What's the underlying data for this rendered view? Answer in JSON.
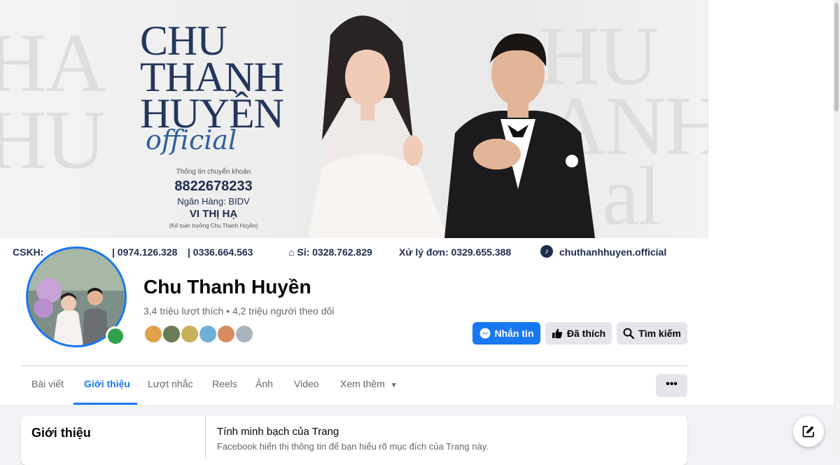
{
  "cover": {
    "title_line1": "CHU",
    "title_line2": "THANH",
    "title_line3": "HUYỀN",
    "official": "official",
    "bank": {
      "caption": "Thông tin chuyển khoản",
      "account": "8822678233",
      "bank_name": "Ngân Hàng: BIDV",
      "holder": "VI THỊ HẠ",
      "note": "(Kế toán trưởng Chu Thanh Huyền)"
    },
    "contacts": {
      "cskh": "CSKH:",
      "phone1": "| 0974.126.328",
      "phone2": "| 0336.664.563",
      "wholesale": "Sỉ: 0328.762.829",
      "orders": "Xử lý đơn: 0329.655.388",
      "tiktok": "chuthanhhuyen.official"
    }
  },
  "profile": {
    "name": "Chu Thanh Huyền",
    "stats": "3,4 triệu lượt thích • 4,2 triệu người theo dõi"
  },
  "actions": {
    "message": "Nhắn tin",
    "liked": "Đã thích",
    "search": "Tìm kiếm",
    "more": "•••"
  },
  "tabs": [
    {
      "label": "Bài viết"
    },
    {
      "label": "Giới thiệu"
    },
    {
      "label": "Lượt nhắc"
    },
    {
      "label": "Reels"
    },
    {
      "label": "Ảnh"
    },
    {
      "label": "Video"
    },
    {
      "label": "Xem thêm"
    }
  ],
  "intro": {
    "title": "Giới thiệu",
    "transparency_title": "Tính minh bạch của Trang",
    "transparency_desc": "Facebook hiển thị thông tin để bạn hiểu rõ mục đích của Trang này."
  },
  "colors": {
    "accent": "#1877f2",
    "online": "#31a24c",
    "cover_navy": "#23365c"
  },
  "icons": [
    "messenger-icon",
    "thumbs-up-icon",
    "search-icon",
    "chevron-down-icon",
    "compose-icon",
    "tiktok-icon"
  ]
}
